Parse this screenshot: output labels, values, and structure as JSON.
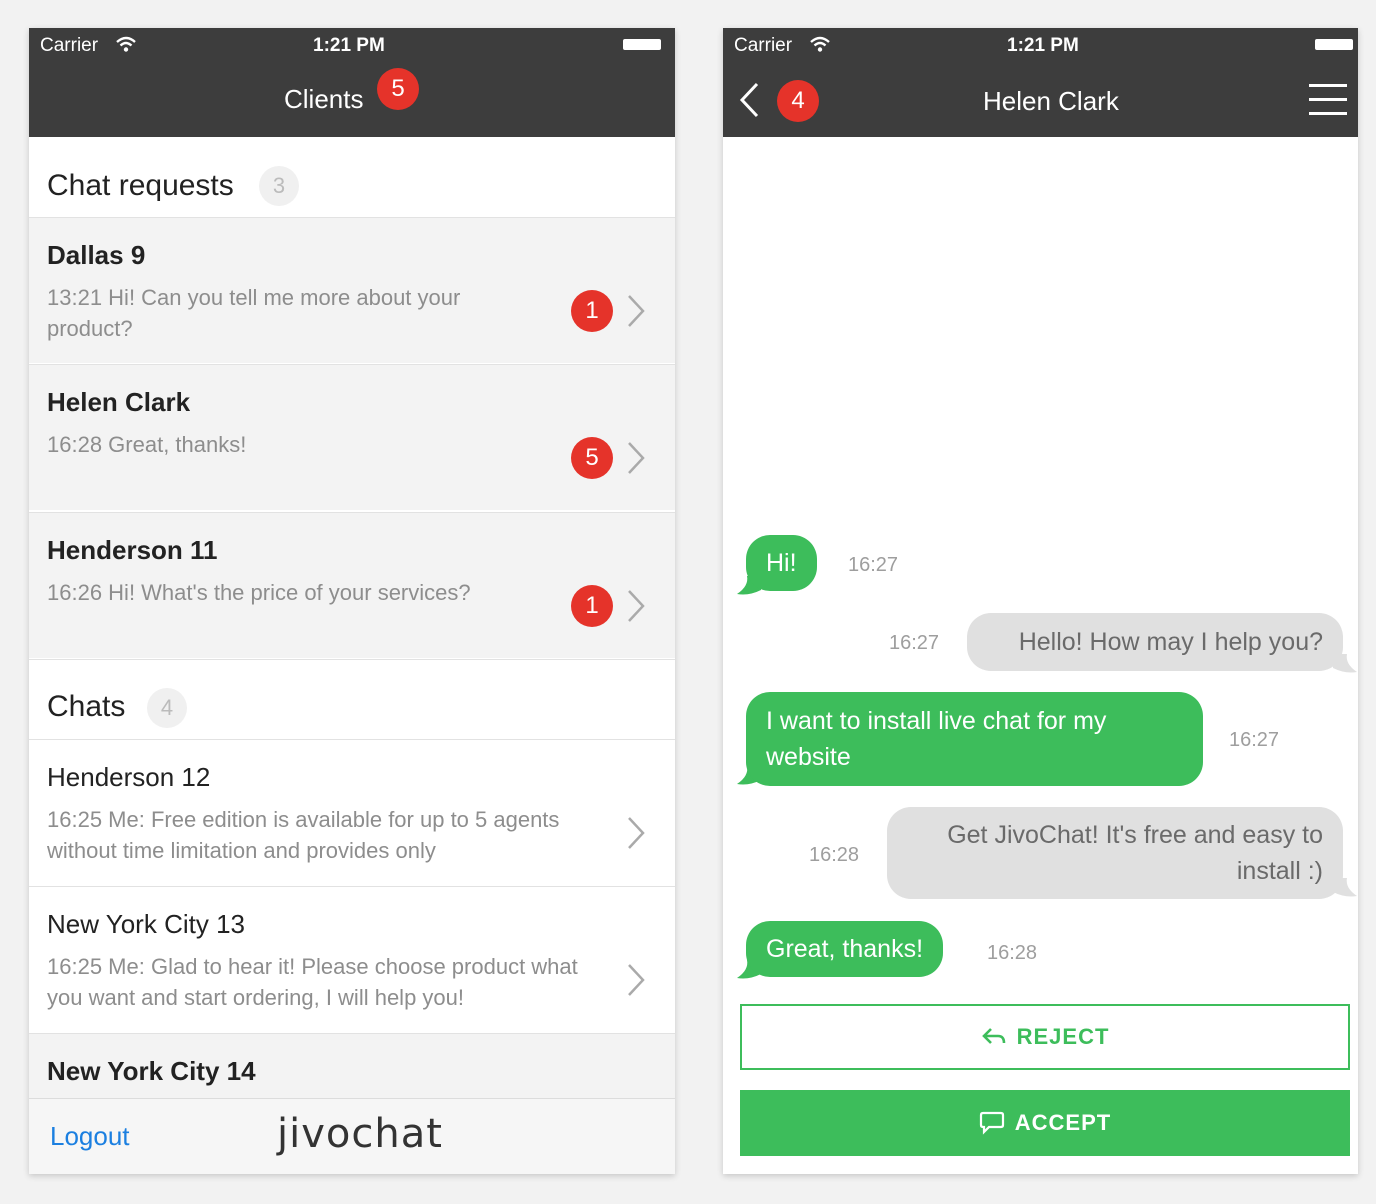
{
  "left": {
    "status": {
      "carrier": "Carrier",
      "time": "1:21 PM"
    },
    "nav": {
      "title": "Clients",
      "badge": "5"
    },
    "requests_header": {
      "label": "Chat requests",
      "count": "3"
    },
    "requests": [
      {
        "name": "Dallas 9",
        "message": "13:21 Hi! Can you tell me more about your product?",
        "unread": "1"
      },
      {
        "name": "Helen Clark",
        "message": "16:28 Great, thanks!",
        "unread": "5"
      },
      {
        "name": "Henderson 11",
        "message": "16:26 Hi! What's the price of your services?",
        "unread": "1"
      }
    ],
    "chats_header": {
      "label": "Chats",
      "count": "4"
    },
    "chats": [
      {
        "name": "Henderson 12",
        "message": "16:25 Me: Free edition is available for up to 5 agents without time limitation and provides only"
      },
      {
        "name": "New York City 13",
        "message": "16:25 Me: Glad to hear it! Please choose product what you want and start ordering, I will help you!"
      },
      {
        "name": "New York City 14",
        "message": ""
      }
    ],
    "bottom": {
      "logout": "Logout",
      "brand": "jivochat"
    }
  },
  "right": {
    "status": {
      "carrier": "Carrier",
      "time": "1:21 PM"
    },
    "nav": {
      "title": "Helen Clark",
      "back_badge": "4"
    },
    "messages": [
      {
        "dir": "in",
        "text": "Hi!",
        "time": "16:27"
      },
      {
        "dir": "out",
        "text": "Hello! How may I help you?",
        "time": "16:27"
      },
      {
        "dir": "in",
        "text": "I want to install live chat for my website",
        "time": "16:27"
      },
      {
        "dir": "out",
        "text": "Get JivoChat! It's free and easy to install :)",
        "time": "16:28"
      },
      {
        "dir": "in",
        "text": "Great, thanks!",
        "time": "16:28"
      }
    ],
    "buttons": {
      "reject": "REJECT",
      "accept": "ACCEPT"
    }
  },
  "colors": {
    "topbar": "#3d3d3d",
    "badge": "#e5332a",
    "green": "#3dbd5b",
    "link": "#1b7fe0"
  },
  "icons": [
    "wifi-icon",
    "battery-icon",
    "chevron-right-icon",
    "back-arrow-icon",
    "hamburger-menu-icon",
    "reply-arrow-icon",
    "chat-bubble-icon"
  ]
}
